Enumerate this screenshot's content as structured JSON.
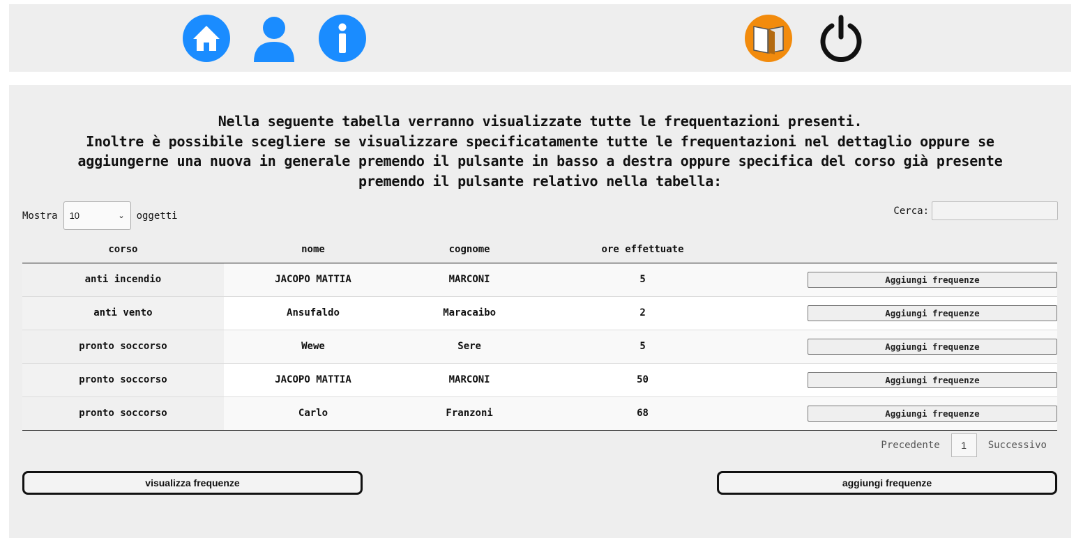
{
  "nav": {
    "icons": [
      "home-icon",
      "user-icon",
      "info-icon",
      "book-icon",
      "power-icon"
    ],
    "colors": {
      "blue": "#1a8cff",
      "orange": "#f28b0c",
      "dark": "#111111"
    }
  },
  "intro": {
    "lines": [
      "Nella seguente tabella verranno visualizzate tutte le frequentazioni presenti.",
      "Inoltre è possibile scegliere se visualizzare specificatamente tutte le frequentazioni nel dettaglio oppure se",
      "aggiungerne una nuova in generale premendo il pulsante in basso a destra oppure specifica del corso già presente",
      "premendo il pulsante relativo nella tabella:"
    ]
  },
  "table_controls": {
    "show_label": "Mostra",
    "show_value": "10",
    "items_label": "oggetti",
    "search_label": "Cerca:",
    "search_value": ""
  },
  "table": {
    "headers": [
      "corso",
      "nome",
      "cognome",
      "ore effettuate",
      ""
    ],
    "rows": [
      {
        "corso": "anti incendio",
        "nome": "JACOPO MATTIA",
        "cognome": "MARCONI",
        "ore": "5",
        "action": "Aggiungi frequenze"
      },
      {
        "corso": "anti vento",
        "nome": "Ansufaldo",
        "cognome": "Maracaibo",
        "ore": "2",
        "action": "Aggiungi frequenze"
      },
      {
        "corso": "pronto soccorso",
        "nome": "Wewe",
        "cognome": "Sere",
        "ore": "5",
        "action": "Aggiungi frequenze"
      },
      {
        "corso": "pronto soccorso",
        "nome": "JACOPO MATTIA",
        "cognome": "MARCONI",
        "ore": "50",
        "action": "Aggiungi frequenze"
      },
      {
        "corso": "pronto soccorso",
        "nome": "Carlo",
        "cognome": "Franzoni",
        "ore": "68",
        "action": "Aggiungi frequenze"
      }
    ]
  },
  "pager": {
    "prev": "Precedente",
    "current": "1",
    "next": "Successivo"
  },
  "actions": {
    "view": "visualizza frequenze",
    "add": "aggiungi frequenze"
  }
}
